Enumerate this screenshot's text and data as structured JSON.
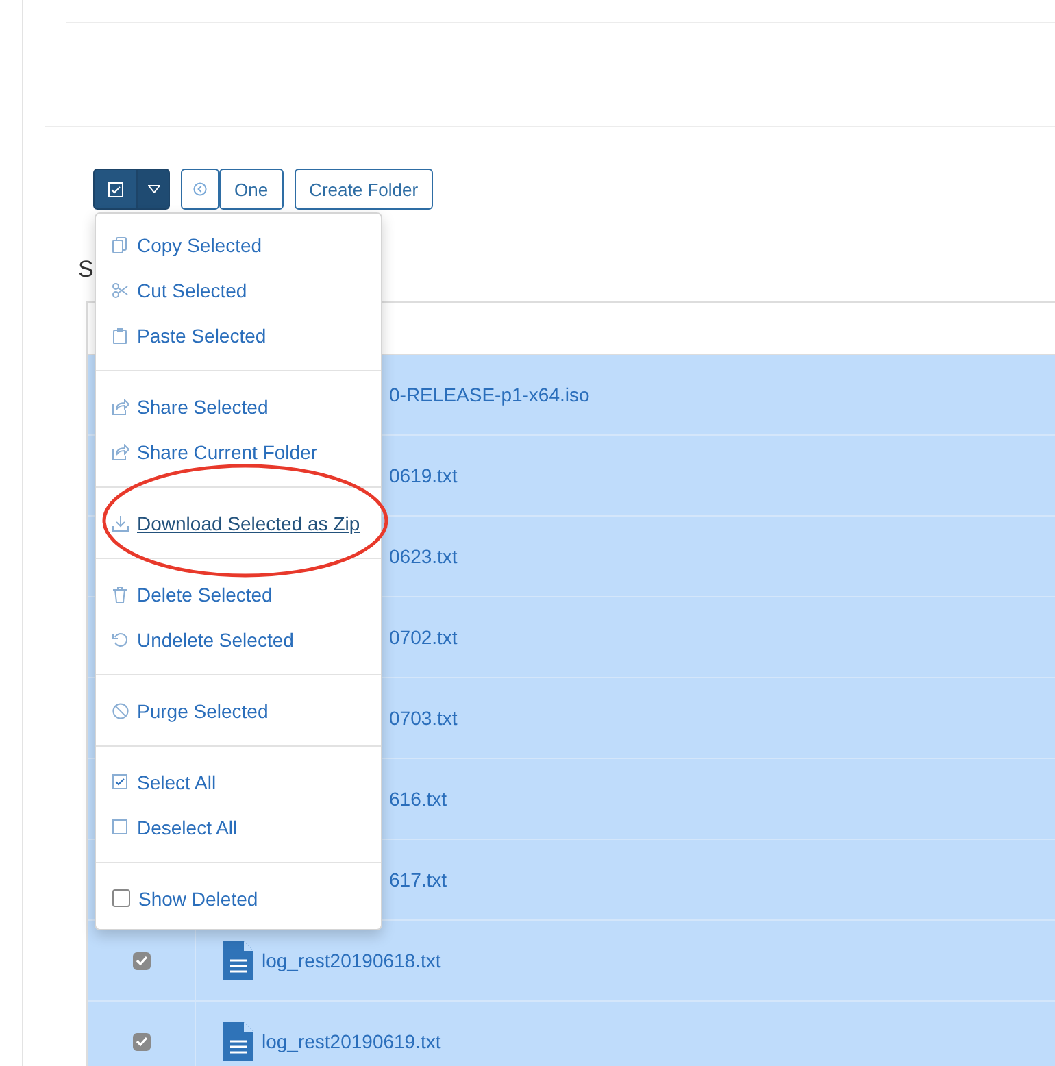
{
  "toolbar": {
    "buttons": [
      {
        "kind": "split"
      },
      {
        "kind": "icon"
      },
      {
        "kind": "text",
        "label": "One"
      },
      {
        "kind": "text",
        "label": "Create Folder"
      }
    ]
  },
  "section_heading": "S",
  "table": {
    "rows": [
      {
        "kind": "partial",
        "name": "0-RELEASE-p1-x64.iso"
      },
      {
        "kind": "partial",
        "name": "0619.txt"
      },
      {
        "kind": "partial",
        "name": "0623.txt"
      },
      {
        "kind": "partial",
        "name": "0702.txt"
      },
      {
        "kind": "partial",
        "name": "0703.txt"
      },
      {
        "kind": "partial",
        "name": "616.txt"
      },
      {
        "kind": "partial",
        "name": "617.txt"
      },
      {
        "kind": "full",
        "name": "log_rest20190618.txt",
        "checked": true
      },
      {
        "kind": "full",
        "name": "log_rest20190619.txt",
        "checked": true
      }
    ]
  },
  "menu": {
    "groups": [
      [
        {
          "kind": "action",
          "label": "Copy Selected",
          "hovered": false
        },
        {
          "kind": "action",
          "label": "Cut Selected",
          "hovered": false
        },
        {
          "kind": "action",
          "label": "Paste Selected",
          "hovered": false
        }
      ],
      [
        {
          "kind": "action",
          "label": "Share Selected",
          "hovered": false
        },
        {
          "kind": "action",
          "label": "Share Current Folder",
          "hovered": false
        }
      ],
      [
        {
          "kind": "action",
          "label": "Download Selected as Zip",
          "hovered": true
        }
      ],
      [
        {
          "kind": "action",
          "label": "Delete Selected",
          "hovered": false
        },
        {
          "kind": "action",
          "label": "Undelete Selected",
          "hovered": false
        }
      ],
      [
        {
          "kind": "action",
          "label": "Purge Selected",
          "hovered": false
        }
      ],
      [
        {
          "kind": "action",
          "label": "Select All",
          "hovered": false
        },
        {
          "kind": "action",
          "label": "Deselect All",
          "hovered": false
        }
      ],
      [
        {
          "kind": "checkbox",
          "label": "Show Deleted",
          "hovered": false,
          "checked": false
        }
      ]
    ]
  },
  "annotation": {
    "kind": "ellipse"
  }
}
